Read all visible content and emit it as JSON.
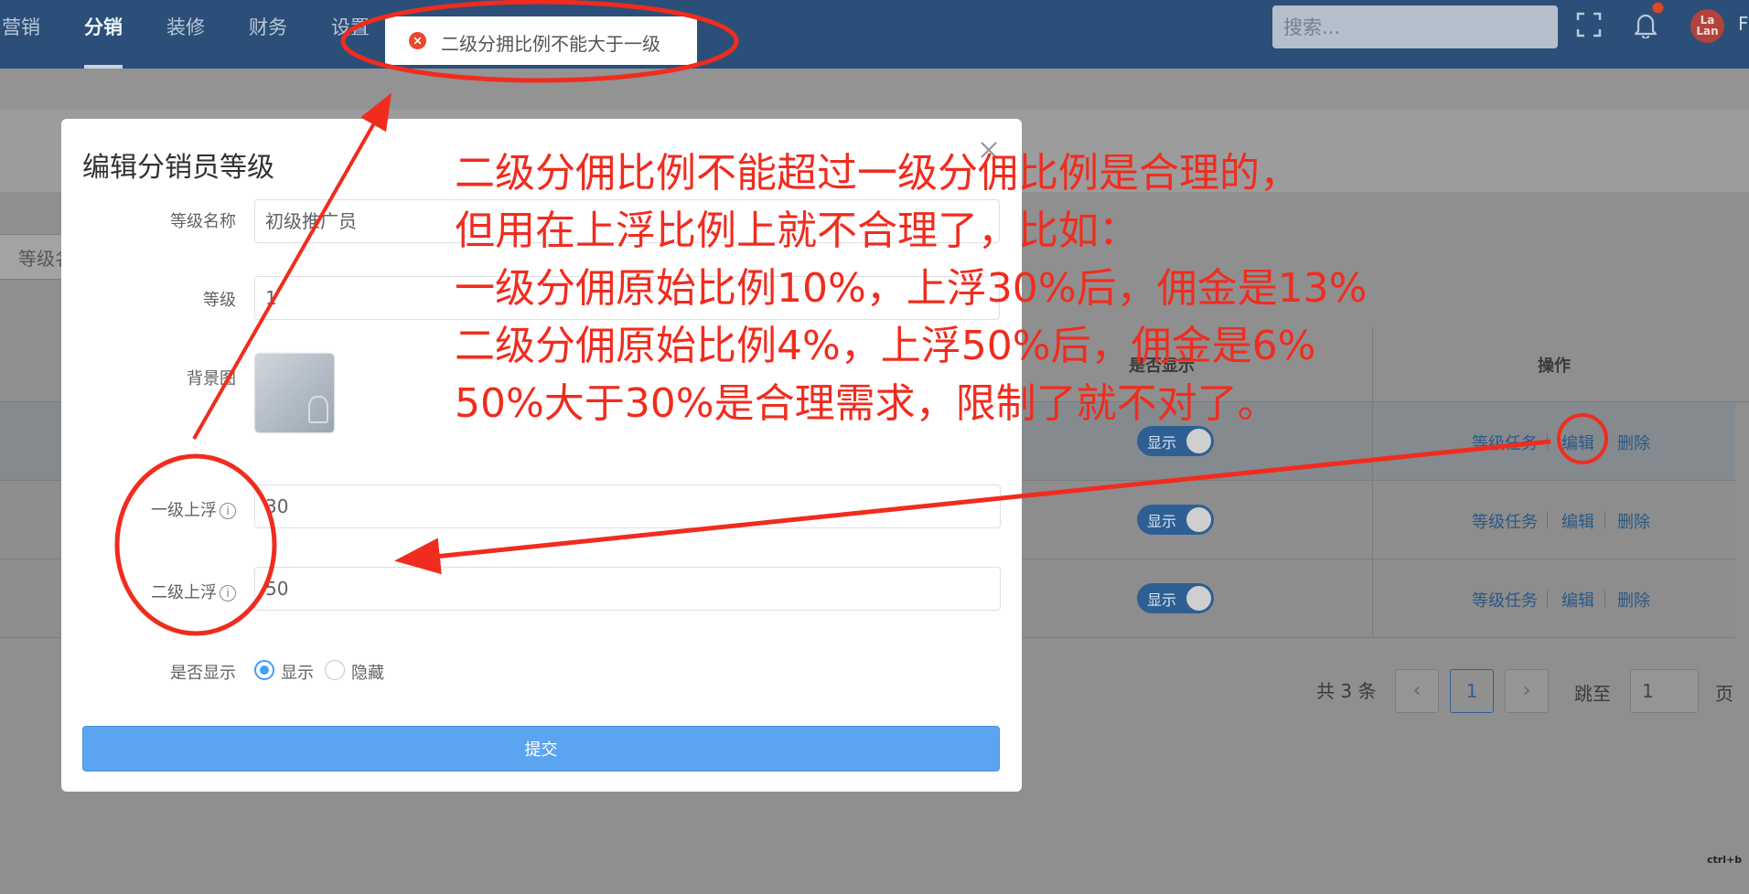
{
  "nav": {
    "items": [
      "营销",
      "分销",
      "装修",
      "财务",
      "设置"
    ],
    "active": "分销",
    "search_placeholder": "搜索...",
    "avatar_text_top": "La",
    "avatar_text_bottom": "Lan",
    "avatar_edge": "F"
  },
  "toast": {
    "type": "error",
    "message": "二级分拥比例不能大于一级"
  },
  "background_page": {
    "filter_label": "等级名",
    "headers": {
      "display": "是否显示",
      "actions": "操作"
    },
    "rows": [
      {
        "display_label": "显示",
        "actions": [
          "等级任务",
          "编辑",
          "删除"
        ]
      },
      {
        "display_label": "显示",
        "actions": [
          "等级任务",
          "编辑",
          "删除"
        ]
      },
      {
        "display_label": "显示",
        "actions": [
          "等级任务",
          "编辑",
          "删除"
        ]
      }
    ],
    "pagination": {
      "total_text": "共 3 条",
      "prev": "‹",
      "current_page": "1",
      "next": "›",
      "jump_label": "跳至",
      "jump_value": "1",
      "page_suffix": "页"
    },
    "watermark": "ctrl+b"
  },
  "modal": {
    "title": "编辑分销员等级",
    "fields": {
      "level_name": {
        "label": "等级名称",
        "value": "初级推广员"
      },
      "level": {
        "label": "等级",
        "value": "1"
      },
      "background": {
        "label": "背景图"
      },
      "first_float": {
        "label": "一级上浮",
        "value": "30"
      },
      "second_float": {
        "label": "二级上浮",
        "value": "50"
      },
      "display": {
        "label": "是否显示",
        "options": [
          "显示",
          "隐藏"
        ],
        "selected": "显示"
      }
    },
    "submit_label": "提交"
  },
  "annotation": {
    "color": "#f02c1e",
    "lines": [
      "二级分佣比例不能超过一级分佣比例是合理的，",
      "但用在上浮比例上就不合理了，比如：",
      "一级分佣原始比例10%，上浮30%后，佣金是13%",
      "二级分佣原始比例4%，上浮50%后，佣金是6%",
      "50%大于30%是合理需求，限制了就不对了。"
    ]
  },
  "colors": {
    "topbar": "#2b4f78",
    "primary": "#409eff",
    "annotation_red": "#f02c1e",
    "error": "#e8472c"
  }
}
